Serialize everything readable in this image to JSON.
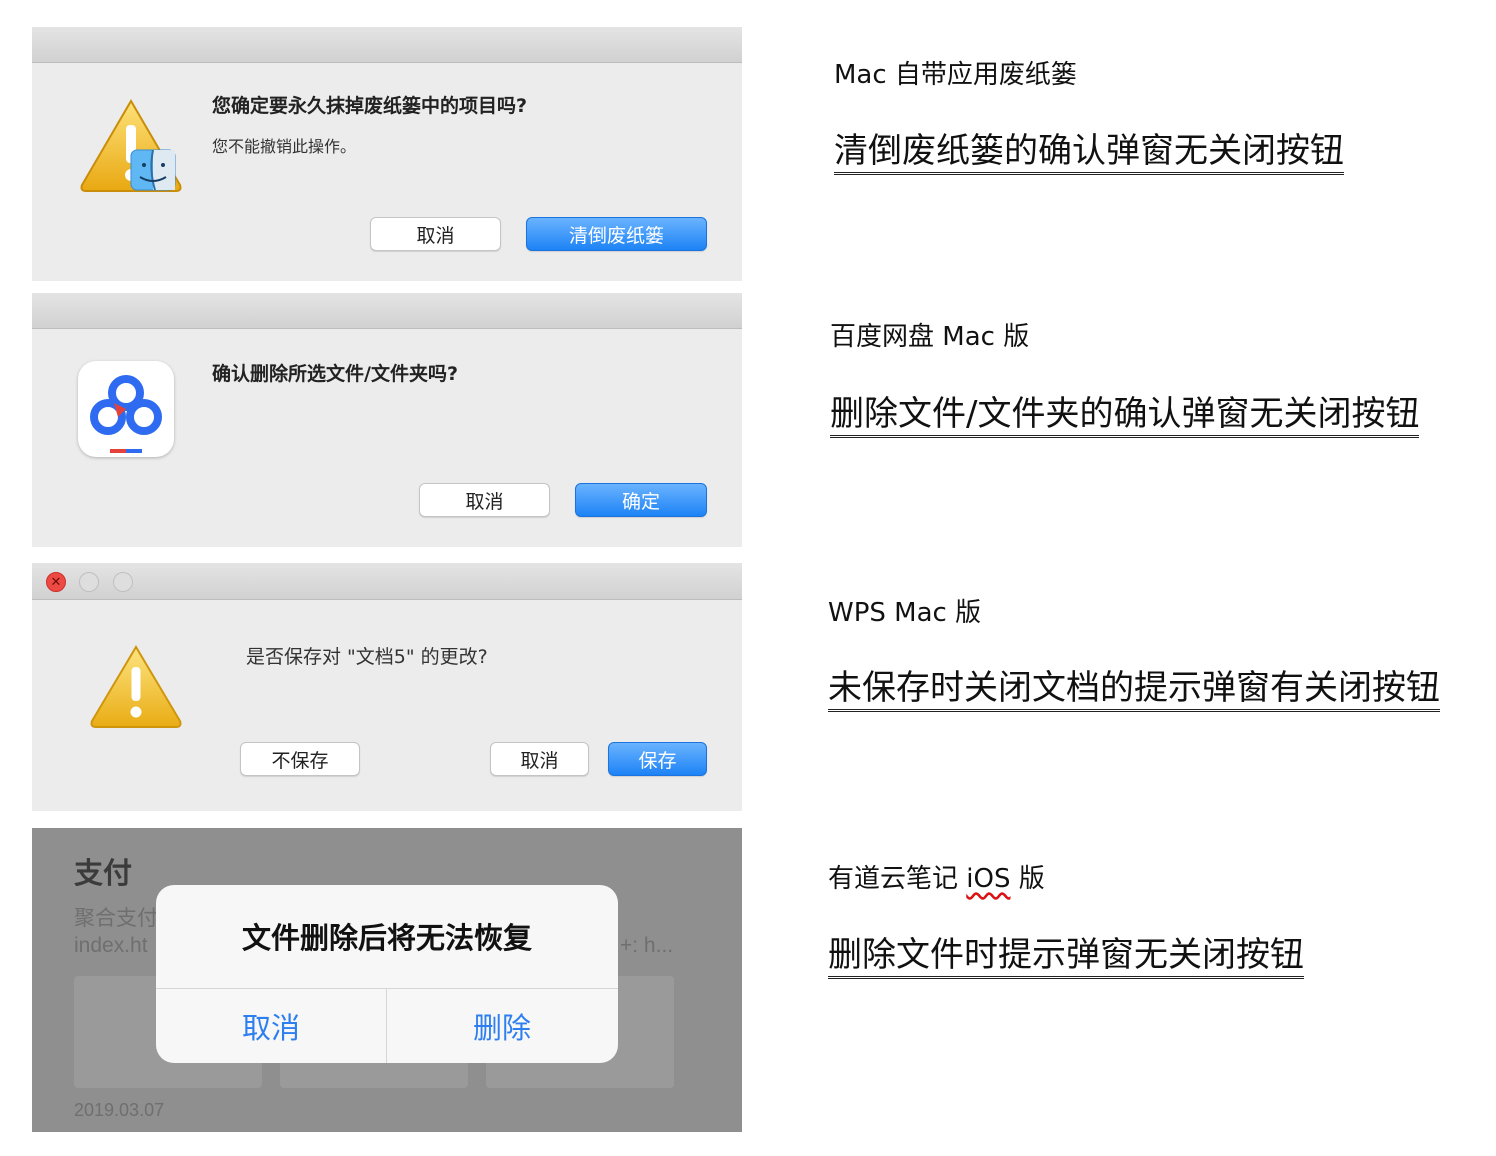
{
  "panel1": {
    "title": "您确定要永久抹掉废纸篓中的项目吗?",
    "subtitle": "您不能撤销此操作。",
    "cancel": "取消",
    "confirm": "清倒废纸篓"
  },
  "panel2": {
    "title": "确认删除所选文件/文件夹吗?",
    "cancel": "取消",
    "confirm": "确定"
  },
  "panel3": {
    "title": "是否保存对 \"文档5\" 的更改?",
    "dont_save": "不保存",
    "cancel": "取消",
    "save": "保存"
  },
  "panel4": {
    "bg_heading": "支付",
    "bg_line1": "聚合支付",
    "bg_line2": "index.ht",
    "bg_right": "+: h...",
    "bg_date": "2019.03.07",
    "alert_title": "文件删除后将无法恢复",
    "cancel": "取消",
    "delete": "删除"
  },
  "notes": [
    {
      "app": "Mac 自带应用废纸篓",
      "desc": "清倒废纸篓的确认弹窗无关闭按钮"
    },
    {
      "app": "百度网盘 Mac 版",
      "desc": "删除文件/文件夹的确认弹窗无关闭按钮"
    },
    {
      "app": "WPS Mac 版",
      "desc": "未保存时关闭文档的提示弹窗有关闭按钮"
    },
    {
      "app_prefix": "有道云笔记 ",
      "app_ios": "iOS",
      "app_suffix": " 版",
      "desc": "删除文件时提示弹窗无关闭按钮"
    }
  ],
  "icons": {
    "warning": "warning-triangle-icon",
    "finder": "finder-icon",
    "baidu": "baidu-netdisk-icon",
    "close": "close-icon"
  },
  "colors": {
    "accent_blue": "#1d83f5",
    "ios_blue": "#2d7ff0",
    "warning_yellow": "#f3c221",
    "close_red": "#ee4a44"
  }
}
